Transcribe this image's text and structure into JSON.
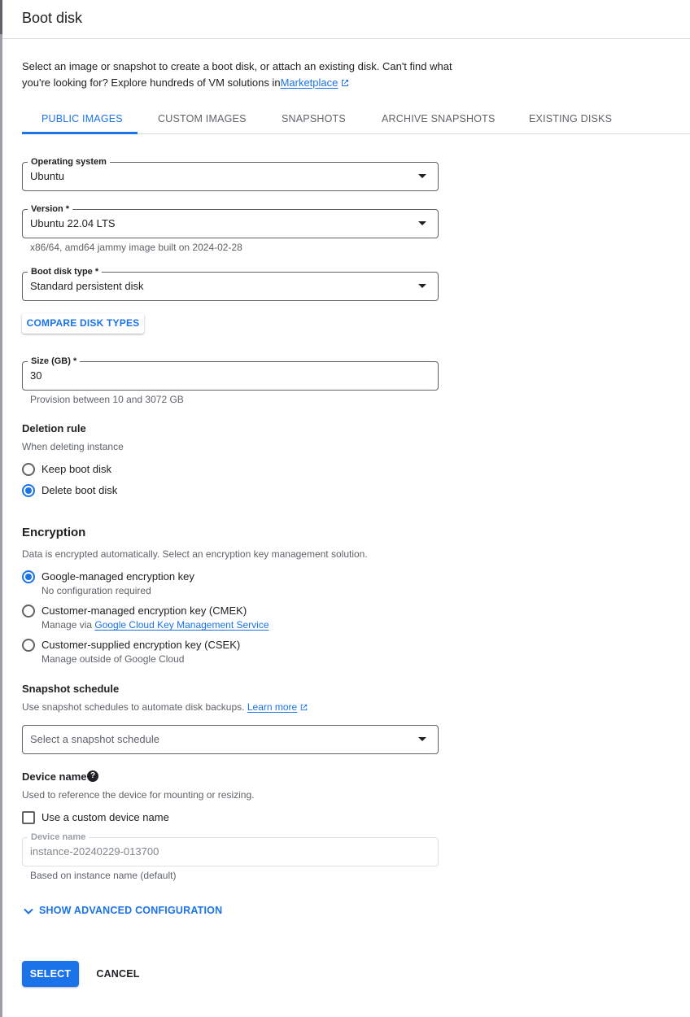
{
  "panel": {
    "title": "Boot disk",
    "intro_text": "Select an image or snapshot to create a boot disk, or attach an existing disk. Can't find what you're looking for? Explore hundreds of VM solutions in",
    "marketplace_link": "Marketplace"
  },
  "tabs": [
    {
      "label": "PUBLIC IMAGES",
      "active": true
    },
    {
      "label": "CUSTOM IMAGES",
      "active": false
    },
    {
      "label": "SNAPSHOTS",
      "active": false
    },
    {
      "label": "ARCHIVE SNAPSHOTS",
      "active": false
    },
    {
      "label": "EXISTING DISKS",
      "active": false
    }
  ],
  "os": {
    "label": "Operating system",
    "value": "Ubuntu"
  },
  "version": {
    "label": "Version *",
    "value": "Ubuntu 22.04 LTS",
    "hint": "x86/64, amd64 jammy image built on 2024-02-28"
  },
  "disk_type": {
    "label": "Boot disk type *",
    "value": "Standard persistent disk"
  },
  "compare_button": "COMPARE DISK TYPES",
  "size": {
    "label": "Size (GB) *",
    "value": "30",
    "hint": "Provision between 10 and 3072 GB"
  },
  "deletion": {
    "title": "Deletion rule",
    "desc": "When deleting instance",
    "options": [
      {
        "label": "Keep boot disk",
        "checked": false
      },
      {
        "label": "Delete boot disk",
        "checked": true
      }
    ]
  },
  "encryption": {
    "title": "Encryption",
    "desc": "Data is encrypted automatically. Select an encryption key management solution.",
    "options": [
      {
        "label": "Google-managed encryption key",
        "sub": "No configuration required",
        "checked": true
      },
      {
        "label": "Customer-managed encryption key (CMEK)",
        "sub_prefix": "Manage via ",
        "sub_link": "Google Cloud Key Management Service",
        "checked": false
      },
      {
        "label": "Customer-supplied encryption key (CSEK)",
        "sub": "Manage outside of Google Cloud",
        "checked": false
      }
    ]
  },
  "snapshot": {
    "title": "Snapshot schedule",
    "desc": "Use snapshot schedules to automate disk backups.",
    "learn_more": "Learn more",
    "placeholder": "Select a snapshot schedule"
  },
  "device": {
    "title": "Device name",
    "help_icon": "?",
    "desc": "Used to reference the device for mounting or resizing.",
    "checkbox_label": "Use a custom device name",
    "field_label": "Device name",
    "field_value": "instance-20240229-013700",
    "hint": "Based on instance name (default)"
  },
  "advanced_label": "SHOW ADVANCED CONFIGURATION",
  "actions": {
    "select": "SELECT",
    "cancel": "CANCEL"
  },
  "colors": {
    "accent": "#1a73e8",
    "text": "#202124",
    "muted": "#5f6368",
    "border": "#dadce0"
  },
  "icons": [
    "external-link-icon",
    "dropdown-caret-icon",
    "help-icon",
    "chevron-down-icon"
  ]
}
